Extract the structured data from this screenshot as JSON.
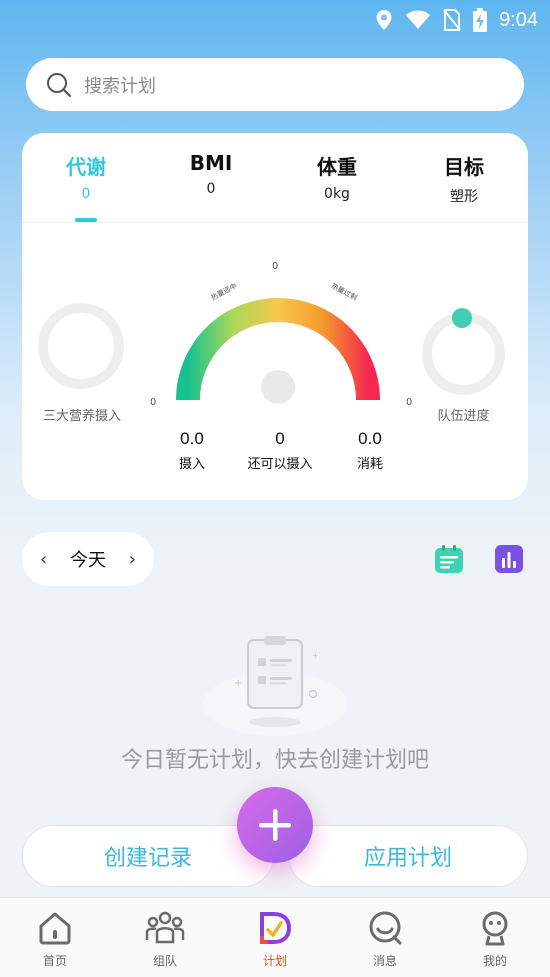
{
  "status_bar": {
    "time": "9:04"
  },
  "search": {
    "placeholder": "搜索计划"
  },
  "tabs": [
    {
      "label": "代谢",
      "value": "0"
    },
    {
      "label": "BMI",
      "value": "0"
    },
    {
      "label": "体重",
      "value": "0kg"
    },
    {
      "label": "目标",
      "value": "塑形"
    }
  ],
  "gauge": {
    "top_value": "0",
    "left_value": "0",
    "right_value": "0",
    "left_tag": "热量适中",
    "right_tag": "热量过剩"
  },
  "rings": {
    "left_caption": "三大营养摄入",
    "right_caption": "队伍进度"
  },
  "stats": [
    {
      "value": "0.0",
      "label": "摄入"
    },
    {
      "value": "0",
      "label": "还可以摄入"
    },
    {
      "value": "0.0",
      "label": "消耗"
    }
  ],
  "date": {
    "label": "今天",
    "prev": "‹",
    "next": "›"
  },
  "empty": {
    "text": "今日暂无计划，快去创建计划吧"
  },
  "actions": {
    "create": "创建记录",
    "apply": "应用计划",
    "fab": "+"
  },
  "nav": [
    {
      "label": "首页",
      "icon": "home-icon"
    },
    {
      "label": "组队",
      "icon": "team-icon"
    },
    {
      "label": "计划",
      "icon": "plan-icon"
    },
    {
      "label": "消息",
      "icon": "message-icon"
    },
    {
      "label": "我的",
      "icon": "profile-icon"
    }
  ],
  "colors": {
    "accent": "#35c6df",
    "fab_start": "#d76be8",
    "fab_end": "#9e5fe4",
    "nav_active": "#d4541c",
    "ring_dot": "#3fcfb0"
  }
}
